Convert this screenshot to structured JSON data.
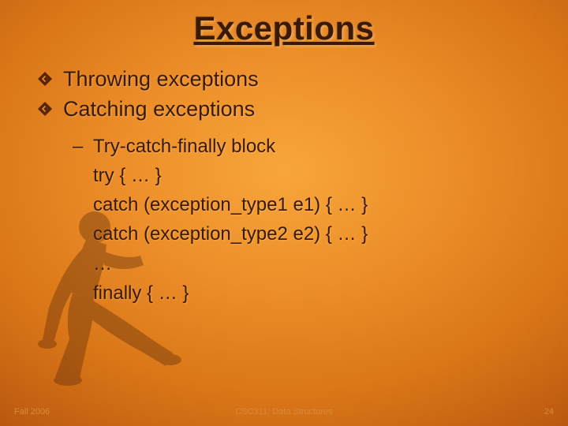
{
  "title": "Exceptions",
  "bullets": [
    "Throwing exceptions",
    "Catching exceptions"
  ],
  "sub": {
    "lead": "Try-catch-finally block",
    "lines": [
      "try { … }",
      "catch (exception_type1 e1) { … }",
      "catch (exception_type2 e2) { … }",
      "…",
      "finally { … }"
    ]
  },
  "footer": {
    "left": "Fall 2006",
    "center": "CSC311: Data Structures",
    "right": "24"
  },
  "icons": {
    "bullet": "diamond-arrow-icon",
    "runner": "sprint-start-icon"
  },
  "colors": {
    "bullet_dark": "#5a2405",
    "bullet_light": "#e8a040",
    "runner": "#5a2a08"
  }
}
